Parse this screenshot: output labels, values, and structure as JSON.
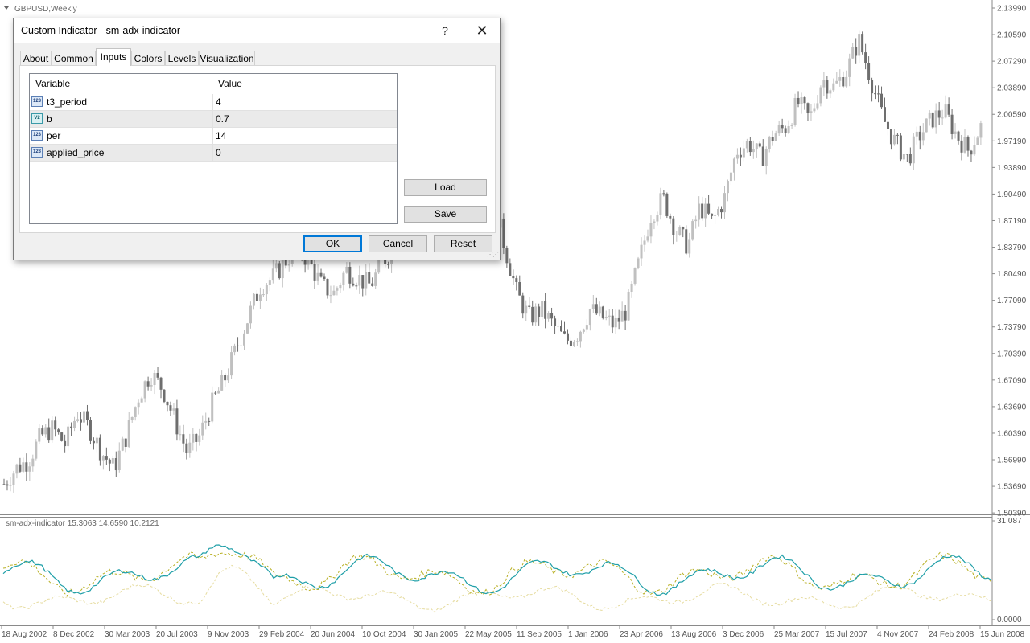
{
  "chart": {
    "symbol_label": "GBPUSD,Weekly",
    "indicator_label": "sm-adx-indicator 15.3063 14.6590 10.2121",
    "price_ticks": [
      "2.13990",
      "2.10590",
      "2.07290",
      "2.03890",
      "2.00590",
      "1.97190",
      "1.93890",
      "1.90490",
      "1.87190",
      "1.83790",
      "1.80490",
      "1.77090",
      "1.73790",
      "1.70390",
      "1.67090",
      "1.63690",
      "1.60390",
      "1.56990",
      "1.53690",
      "1.50390"
    ],
    "indicator_ticks": [
      "31.087",
      "0.0000"
    ],
    "date_ticks": [
      "18 Aug 2002",
      "8 Dec 2002",
      "30 Mar 2003",
      "20 Jul 2003",
      "9 Nov 2003",
      "29 Feb 2004",
      "20 Jun 2004",
      "10 Oct 2004",
      "30 Jan 2005",
      "22 May 2005",
      "11 Sep 2005",
      "1 Jan 2006",
      "23 Apr 2006",
      "13 Aug 2006",
      "3 Dec 2006",
      "25 Mar 2007",
      "15 Jul 2007",
      "4 Nov 2007",
      "24 Feb 2008",
      "15 Jun 2008"
    ],
    "colors": {
      "bull_candle": "#c0c0c0",
      "bear_candle": "#6e6e6e",
      "adx_line": "#1f9fa8",
      "plus_di": "#b8b024",
      "minus_di": "#e6dca0"
    }
  },
  "chart_data": {
    "type": "candlestick",
    "title": "GBPUSD,Weekly",
    "ylim": [
      1.5039,
      2.1399
    ],
    "close_path": [
      1.54,
      1.56,
      1.57,
      1.6,
      1.61,
      1.59,
      1.63,
      1.61,
      1.58,
      1.56,
      1.6,
      1.65,
      1.68,
      1.66,
      1.62,
      1.58,
      1.6,
      1.64,
      1.67,
      1.71,
      1.75,
      1.79,
      1.8,
      1.82,
      1.84,
      1.82,
      1.79,
      1.78,
      1.81,
      1.8,
      1.79,
      1.82,
      1.84,
      1.86,
      1.88,
      1.9,
      1.92,
      1.95,
      1.98,
      1.96,
      1.9,
      1.84,
      1.78,
      1.75,
      1.76,
      1.74,
      1.72,
      1.73,
      1.76,
      1.75,
      1.74,
      1.76,
      1.82,
      1.88,
      1.9,
      1.86,
      1.84,
      1.89,
      1.87,
      1.9,
      1.96,
      1.97,
      1.95,
      1.98,
      1.99,
      2.02,
      2.0,
      2.05,
      2.04,
      2.06,
      2.1,
      2.05,
      2.0,
      1.97,
      1.95,
      1.98,
      2.0,
      2.01,
      1.98,
      1.96,
      1.99
    ],
    "indicator": {
      "name": "sm-adx-indicator",
      "values": [
        15.3063,
        14.659,
        10.2121
      ],
      "ylim": [
        0,
        31.087
      ]
    }
  },
  "dialog": {
    "title": "Custom Indicator - sm-adx-indicator",
    "help_label": "?",
    "close_label": "✕",
    "tabs": [
      {
        "label": "About"
      },
      {
        "label": "Common"
      },
      {
        "label": "Inputs"
      },
      {
        "label": "Colors"
      },
      {
        "label": "Levels"
      },
      {
        "label": "Visualization"
      }
    ],
    "active_tab": "Inputs",
    "table": {
      "headers": [
        "Variable",
        "Value"
      ],
      "rows": [
        {
          "icon": "integer-type-icon",
          "icon_text": "123",
          "name": "t3_period",
          "value": "4"
        },
        {
          "icon": "double-type-icon",
          "icon_text": "V2",
          "name": "b",
          "value": "0.7"
        },
        {
          "icon": "integer-type-icon",
          "icon_text": "123",
          "name": "per",
          "value": "14"
        },
        {
          "icon": "integer-type-icon",
          "icon_text": "123",
          "name": "applied_price",
          "value": "0"
        }
      ]
    },
    "buttons": {
      "load": "Load",
      "save": "Save",
      "ok": "OK",
      "cancel": "Cancel",
      "reset": "Reset"
    }
  }
}
